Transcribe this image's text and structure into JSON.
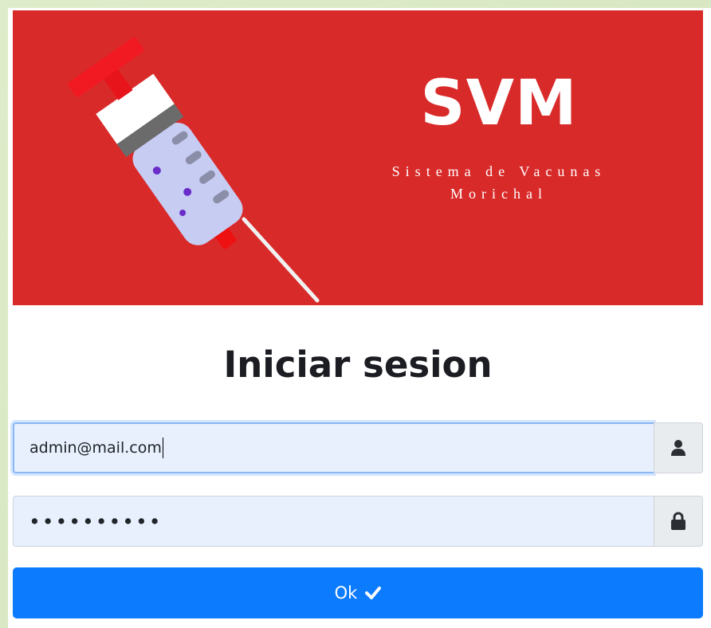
{
  "brand": {
    "title": "SVM",
    "subtitle_line1": "Sistema de Vacunas",
    "subtitle_line2": "Morichal"
  },
  "login": {
    "title": "Iniciar sesion",
    "email_value": "admin@mail.com",
    "password_masked": "••••••••••",
    "email_icon": "user-icon",
    "password_icon": "lock-icon",
    "submit_label": "Ok",
    "submit_icon": "check-icon"
  },
  "colors": {
    "banner": "#d92a2a",
    "button": "#0d7bfd",
    "input_bg": "#e8f0fe",
    "page_bg": "#dfeccb"
  }
}
